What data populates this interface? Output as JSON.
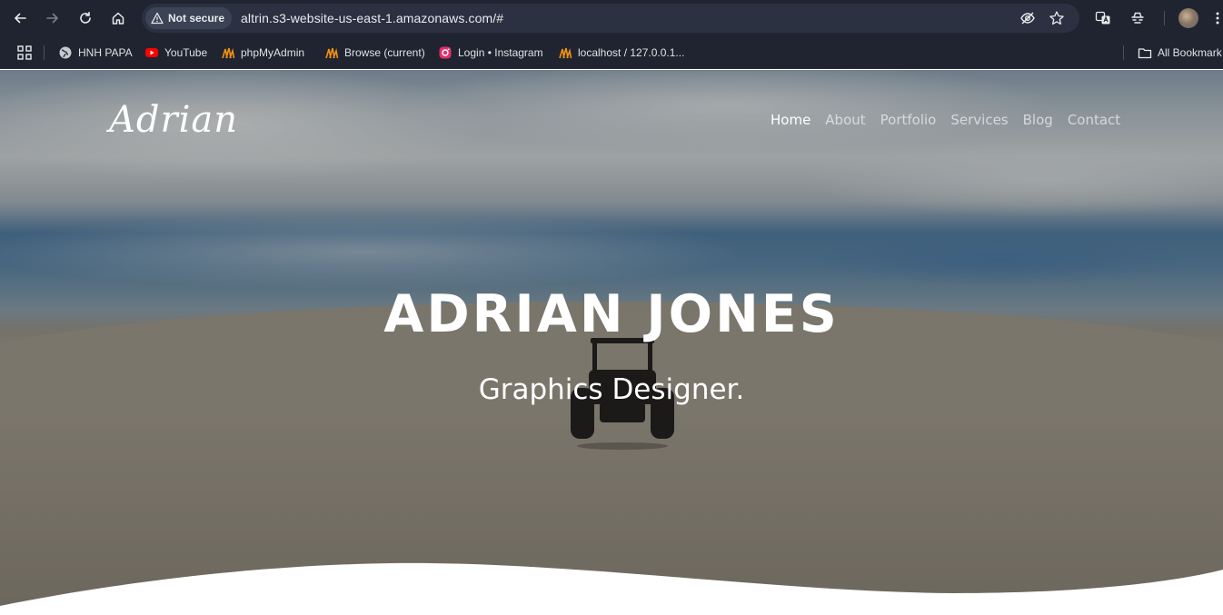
{
  "browser": {
    "security_label": "Not secure",
    "url": "altrin.s3-website-us-east-1.amazonaws.com/#",
    "icons": [
      "back-icon",
      "forward-icon",
      "reload-icon",
      "home-icon",
      "warning-icon",
      "eye-off-icon",
      "star-icon",
      "translate-icon",
      "extensions-icon",
      "menu-icon"
    ]
  },
  "bookmarks": {
    "items": [
      {
        "label": "HNH PAPA",
        "icon": "globe-icon"
      },
      {
        "label": "YouTube",
        "icon": "youtube-icon"
      },
      {
        "label": "phpMyAdmin",
        "icon": "phpmyadmin-icon"
      },
      {
        "label": "Browse (current)",
        "icon": "phpmyadmin-icon"
      },
      {
        "label": "Login • Instagram",
        "icon": "instagram-icon"
      },
      {
        "label": "localhost / 127.0.0.1...",
        "icon": "phpmyadmin-icon"
      }
    ],
    "all_bookmarks": "All Bookmark"
  },
  "site": {
    "logo": "Adrian",
    "nav": [
      {
        "label": "Home",
        "active": true
      },
      {
        "label": "About"
      },
      {
        "label": "Portfolio"
      },
      {
        "label": "Services"
      },
      {
        "label": "Blog"
      },
      {
        "label": "Contact"
      }
    ],
    "hero_title": "ADRIAN JONES",
    "hero_subtitle": "Graphics Designer."
  },
  "colors": {
    "chrome_bg": "#1f2430",
    "omnibox_bg": "#2b3140",
    "hero_text": "#ffffff",
    "youtube_red": "#ff0000",
    "instagram": "#e1306c"
  }
}
